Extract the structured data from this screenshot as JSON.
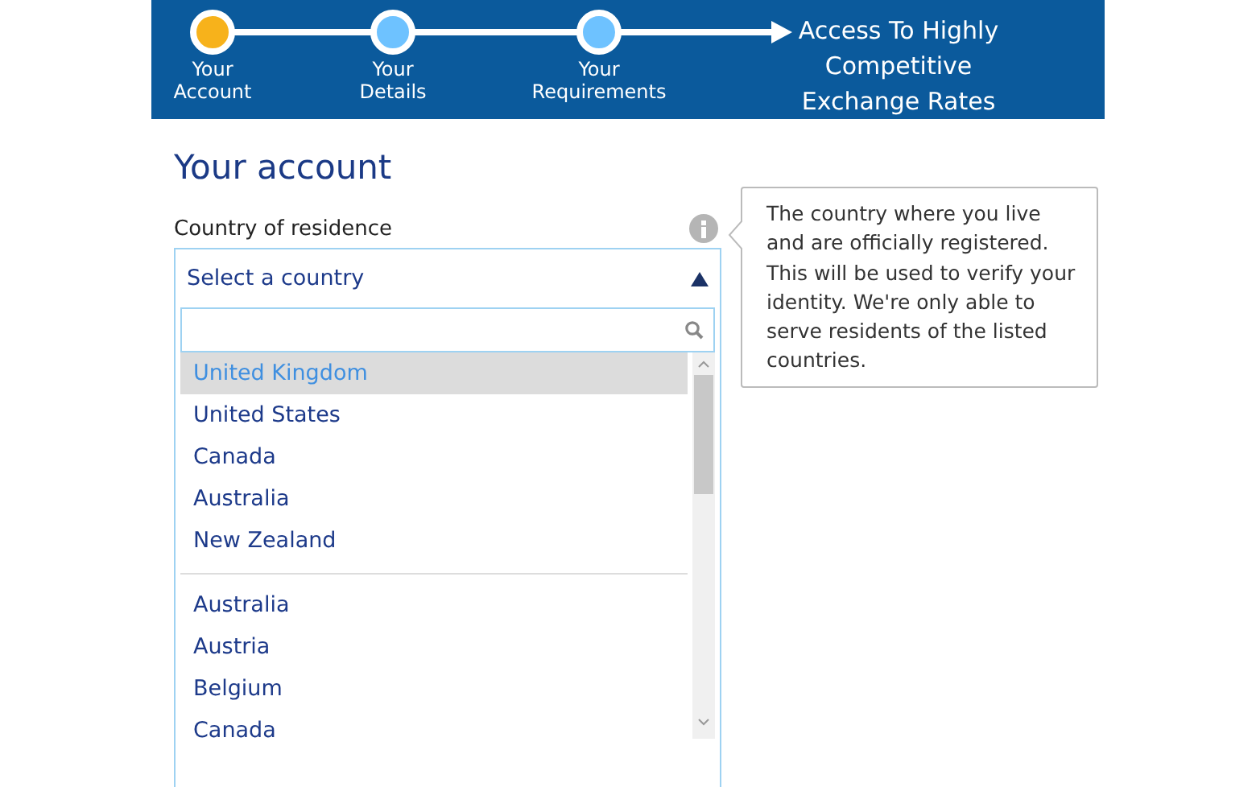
{
  "progress": {
    "steps": [
      {
        "label": "Your Account",
        "selected": true
      },
      {
        "label": "Your Details",
        "selected": false
      },
      {
        "label": "Your Requirements",
        "selected": false
      }
    ],
    "goal": "Access To Highly Competitive Exchange Rates"
  },
  "heading": "Your account",
  "field": {
    "label": "Country of residence",
    "value": "Select a country",
    "expanded": true,
    "tooltip": "The country where you live and are officially registered. This will be used to verify your identity. We're only able to serve residents of the listed countries."
  },
  "dropdown": {
    "groups": [
      [
        {
          "label": "United Kingdom",
          "selected": true
        },
        {
          "label": "United States",
          "selected": false
        },
        {
          "label": "Canada",
          "selected": false
        },
        {
          "label": "Australia",
          "selected": false
        },
        {
          "label": "New Zealand",
          "selected": false
        }
      ],
      [
        {
          "label": "Australia",
          "selected": false
        },
        {
          "label": "Austria",
          "selected": false
        },
        {
          "label": "Belgium",
          "selected": false
        },
        {
          "label": "Canada",
          "selected": false
        }
      ]
    ]
  }
}
